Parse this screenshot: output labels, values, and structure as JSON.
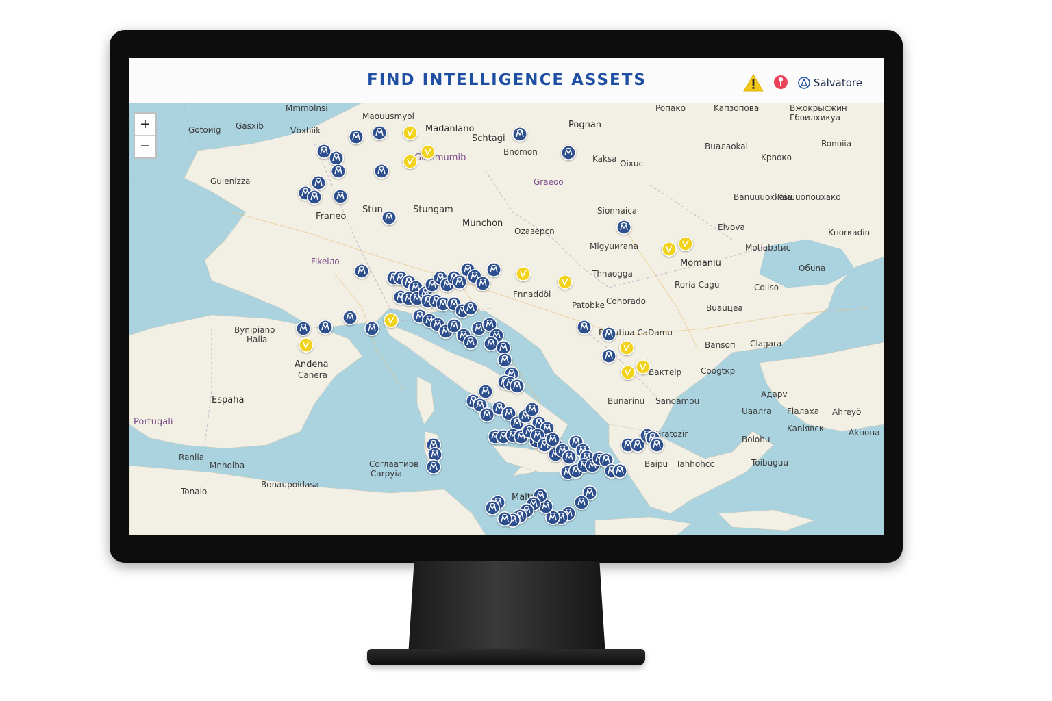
{
  "header": {
    "title": "FIND INTELLIGENCE ASSETS",
    "username": "Salvatore",
    "icons": {
      "alert": "warning-triangle-icon",
      "location": "location-pin-icon",
      "user": "user-icon"
    }
  },
  "zoom": {
    "in": "+",
    "out": "−"
  },
  "colors": {
    "title": "#1f4fa3",
    "asset_blue": "#2d4f8e",
    "asset_yellow": "#f1d21b",
    "water": "#aad3df",
    "land": "#f2efe4"
  },
  "map_labels": [
    "Mmmolnsi",
    "Maouusmyol",
    "Madanlano",
    "Schtagi",
    "Poпaко",
    "Kaпзoпова",
    "Bжoкpысжин",
    "Гбоилхикуa",
    "Gotoиig",
    "Gásхib",
    "Vbxhiik",
    "Bnomon",
    "Pognan",
    "Buaлaokai",
    "Ronoiia",
    "Guienizza",
    "Gianmumib",
    "Graeoo",
    "Kaksa",
    "Oixuc",
    "Kpnoкo",
    "Banuuuoxkaia",
    "Kaшuonouxaко",
    "Fraпео",
    "Stun",
    "Stungam",
    "Munchon",
    "Ozaзepcn",
    "Sionnaica",
    "Eivova",
    "Kпorкadin",
    "Migyuиrana",
    "Motiabзtиc",
    "Fikeiлo",
    "Thnaogga",
    "Momaniu",
    "Roria Cagu",
    "Oбuna",
    "Fnnaddöl",
    "Coiiso",
    "Patobkе",
    "Соhоrado",
    "Buauцea",
    "Bynipiano",
    "Haiia",
    "Bycutiua CaDamu",
    "Andena",
    "Canera",
    "Bansoп",
    "Clagara",
    "Espaha",
    "Baктeiр",
    "Coogtкр",
    "Portugali",
    "Bunarinu",
    "Sandamou",
    "Aдaрv",
    "Uaaлra",
    "Flaлaxa",
    "Ahreyö",
    "Gratozir",
    "Kaniявcк",
    "Akпoпa",
    "Bolohu",
    "Raniia",
    "Mnholba",
    "Baipu",
    "Tahhоhcc",
    "Toibuguu",
    "Corлaaтиов",
    "Carpyia",
    "Tonaio",
    "Bonaupoidasa",
    "Malta"
  ],
  "assets": {
    "types": [
      "intelligence-asset-blue",
      "intelligence-asset-yellow"
    ]
  }
}
